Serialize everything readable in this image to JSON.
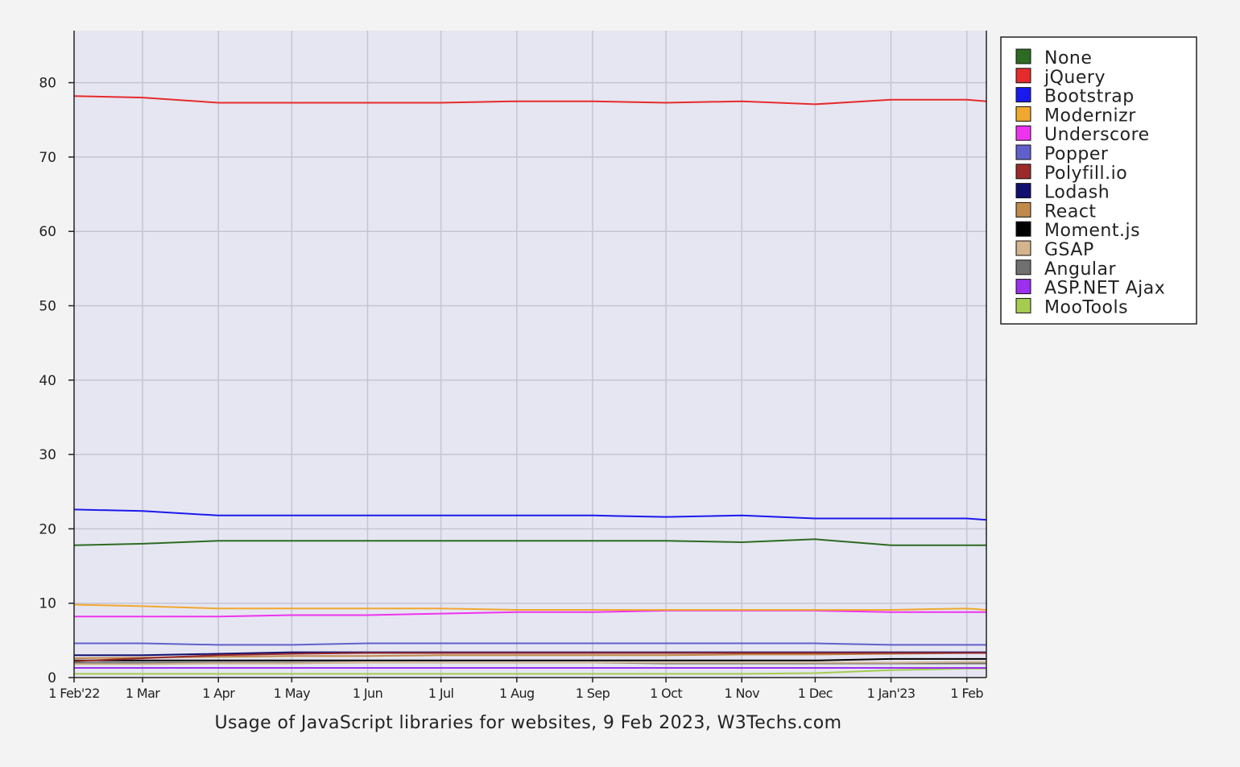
{
  "chart_data": {
    "type": "line",
    "title": "",
    "caption": "Usage of JavaScript libraries for websites, 9 Feb 2023, W3Techs.com",
    "xlabel": "",
    "ylabel": "",
    "x_ticks": [
      "1 Feb'22",
      "1 Mar",
      "1 Apr",
      "1 May",
      "1 Jun",
      "1 Jul",
      "1 Aug",
      "1 Sep",
      "1 Oct",
      "1 Nov",
      "1 Dec",
      "1 Jan'23",
      "1 Feb"
    ],
    "x_tick_days": [
      0,
      28,
      59,
      89,
      120,
      150,
      181,
      212,
      242,
      273,
      303,
      334,
      365
    ],
    "x_end_day": 373,
    "ylim": [
      0,
      87
    ],
    "y_ticks": [
      0,
      10,
      20,
      30,
      40,
      50,
      60,
      70,
      80
    ],
    "grid": true,
    "legend_position": "right",
    "x": [
      "2022-02-01",
      "2022-03-01",
      "2022-04-01",
      "2022-05-01",
      "2022-06-01",
      "2022-07-01",
      "2022-08-01",
      "2022-09-01",
      "2022-10-01",
      "2022-11-01",
      "2022-12-01",
      "2023-01-01",
      "2023-02-01",
      "2023-02-09"
    ],
    "series": [
      {
        "name": "None",
        "color": "#2e6b22",
        "values": [
          17.8,
          18.0,
          18.4,
          18.4,
          18.4,
          18.4,
          18.4,
          18.4,
          18.4,
          18.2,
          18.6,
          17.8,
          17.8,
          17.8
        ]
      },
      {
        "name": "jQuery",
        "color": "#e52b2b",
        "values": [
          78.2,
          78.0,
          77.3,
          77.3,
          77.3,
          77.3,
          77.5,
          77.5,
          77.3,
          77.5,
          77.1,
          77.7,
          77.7,
          77.5
        ]
      },
      {
        "name": "Bootstrap",
        "color": "#1a1aee",
        "values": [
          22.6,
          22.4,
          21.8,
          21.8,
          21.8,
          21.8,
          21.8,
          21.8,
          21.6,
          21.8,
          21.4,
          21.4,
          21.4,
          21.2
        ]
      },
      {
        "name": "Modernizr",
        "color": "#f0a830",
        "values": [
          9.8,
          9.6,
          9.3,
          9.3,
          9.3,
          9.3,
          9.1,
          9.1,
          9.1,
          9.1,
          9.1,
          9.1,
          9.3,
          9.1
        ]
      },
      {
        "name": "Underscore",
        "color": "#ee33ee",
        "values": [
          8.2,
          8.2,
          8.2,
          8.4,
          8.4,
          8.6,
          8.8,
          8.8,
          9.0,
          9.0,
          9.0,
          8.8,
          8.8,
          8.8
        ]
      },
      {
        "name": "Popper",
        "color": "#6060cc",
        "values": [
          4.6,
          4.6,
          4.4,
          4.4,
          4.6,
          4.6,
          4.6,
          4.6,
          4.6,
          4.6,
          4.6,
          4.4,
          4.4,
          4.4
        ]
      },
      {
        "name": "Polyfill.io",
        "color": "#9b2b2b",
        "values": [
          2.2,
          2.6,
          3.0,
          3.2,
          3.3,
          3.3,
          3.3,
          3.3,
          3.3,
          3.3,
          3.3,
          3.3,
          3.3,
          3.3
        ]
      },
      {
        "name": "Lodash",
        "color": "#10106e",
        "values": [
          3.0,
          3.0,
          3.2,
          3.4,
          3.4,
          3.4,
          3.4,
          3.4,
          3.4,
          3.4,
          3.4,
          3.4,
          3.4,
          3.4
        ]
      },
      {
        "name": "React",
        "color": "#c08a4a",
        "values": [
          2.6,
          2.7,
          2.8,
          2.9,
          2.9,
          3.0,
          3.0,
          3.0,
          3.0,
          3.1,
          3.1,
          3.2,
          3.3,
          3.4
        ]
      },
      {
        "name": "Moment.js",
        "color": "#000000",
        "values": [
          2.3,
          2.3,
          2.3,
          2.3,
          2.3,
          2.3,
          2.3,
          2.3,
          2.3,
          2.3,
          2.3,
          2.5,
          2.5,
          2.5
        ]
      },
      {
        "name": "GSAP",
        "color": "#d4b48c",
        "values": [
          1.8,
          1.8,
          1.9,
          1.9,
          2.0,
          2.0,
          2.0,
          2.0,
          2.0,
          2.0,
          2.0,
          2.0,
          2.1,
          2.1
        ]
      },
      {
        "name": "Angular",
        "color": "#707070",
        "values": [
          2.0,
          2.0,
          2.0,
          2.0,
          2.0,
          2.0,
          2.0,
          2.0,
          1.9,
          1.9,
          1.9,
          1.9,
          1.9,
          1.9
        ]
      },
      {
        "name": "ASP.NET Ajax",
        "color": "#9b30ee",
        "values": [
          1.3,
          1.3,
          1.3,
          1.3,
          1.3,
          1.3,
          1.3,
          1.3,
          1.3,
          1.3,
          1.3,
          1.3,
          1.3,
          1.3
        ]
      },
      {
        "name": "MooTools",
        "color": "#a5cc50",
        "values": [
          0.5,
          0.5,
          0.5,
          0.5,
          0.5,
          0.5,
          0.5,
          0.5,
          0.5,
          0.5,
          0.6,
          1.0,
          1.2,
          1.2
        ]
      }
    ]
  }
}
